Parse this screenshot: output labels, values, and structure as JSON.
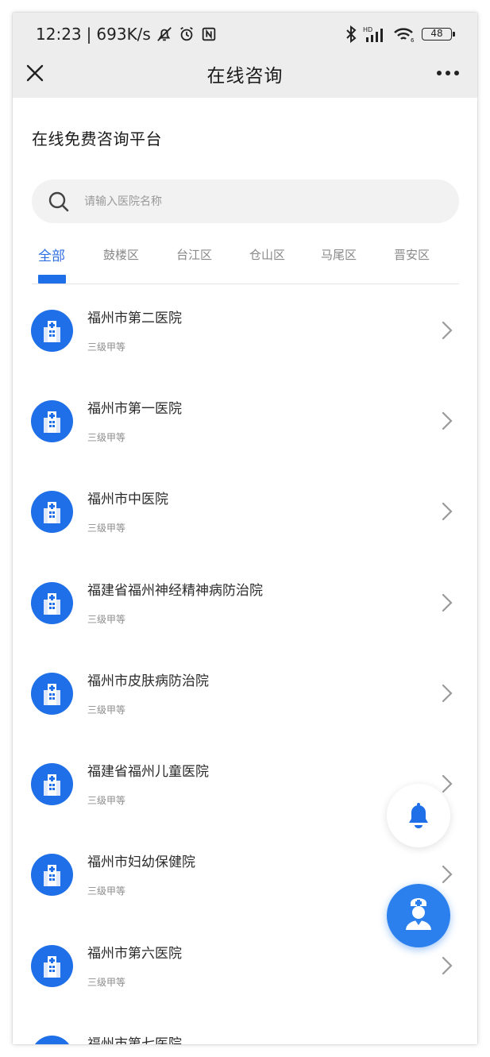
{
  "status_bar": {
    "time": "12:23",
    "separator": "|",
    "speed": "693K/s",
    "battery": "48"
  },
  "nav": {
    "title": "在线咨询"
  },
  "heading": "在线免费咨询平台",
  "search": {
    "placeholder": "请输入医院名称"
  },
  "tabs": [
    {
      "label": "全部",
      "active": true
    },
    {
      "label": "鼓楼区"
    },
    {
      "label": "台江区"
    },
    {
      "label": "仓山区"
    },
    {
      "label": "马尾区"
    },
    {
      "label": "晋安区"
    }
  ],
  "hospitals": [
    {
      "name": "福州市第二医院",
      "level": "三级甲等"
    },
    {
      "name": "福州市第一医院",
      "level": "三级甲等"
    },
    {
      "name": "福州市中医院",
      "level": "三级甲等"
    },
    {
      "name": "福建省福州神经精神病防治院",
      "level": "三级甲等"
    },
    {
      "name": "福州市皮肤病防治院",
      "level": "三级甲等"
    },
    {
      "name": "福建省福州儿童医院",
      "level": "三级甲等"
    },
    {
      "name": "福州市妇幼保健院",
      "level": "三级甲等"
    },
    {
      "name": "福州市第六医院",
      "level": "三级甲等"
    },
    {
      "name": "福州市第七医院",
      "level": ""
    }
  ],
  "colors": {
    "accent": "#1f6fe8",
    "tab_active": "#2f6fe0",
    "fab_doctor": "#2b80ee"
  },
  "icons": {
    "close": "close-icon",
    "more": "more-icon",
    "search": "search-icon",
    "hospital": "hospital-icon",
    "chevron": "chevron-right-icon",
    "bell": "bell-icon",
    "doctor": "doctor-icon"
  }
}
